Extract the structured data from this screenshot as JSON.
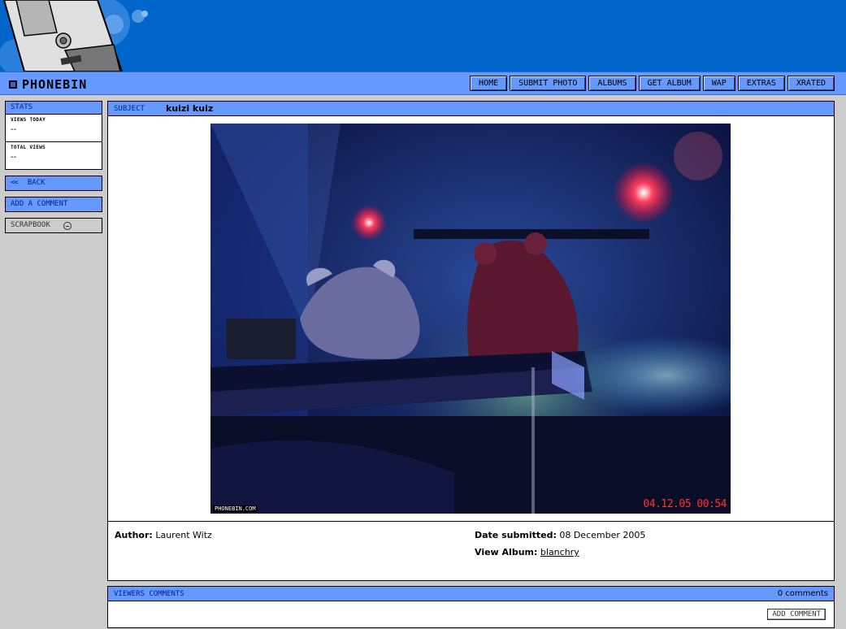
{
  "brand": {
    "logo_text": "PHONEBIN"
  },
  "nav": {
    "items": [
      "HOME",
      "SUBMIT PHOTO",
      "ALBUMS",
      "GET ALBUM",
      "WAP",
      "EXTRAS",
      "XRATED"
    ]
  },
  "sidebar": {
    "stats_title": "STATS",
    "views_today_label": "VIEWS TODAY",
    "views_today_value": "--",
    "total_views_label": "TOTAL VIEWS",
    "total_views_value": "--",
    "back_arrow": "<<",
    "back_label": "BACK",
    "add_comment_label": "ADD A COMMENT",
    "scrapbook_label": "SCRAPBOOK"
  },
  "photo": {
    "subject_label": "SUBJECT",
    "subject_title": "kuizi kuiz",
    "credit": "PHONEBIN.COM",
    "timestamp": "04.12.05 00:54"
  },
  "meta": {
    "author_label": "Author:",
    "author_value": "Laurent Witz",
    "date_label": "Date submitted:",
    "date_value": "08 December 2005",
    "album_label": "View Album:",
    "album_value": "blanchry"
  },
  "comments": {
    "title": "VIEWERS COMMENTS",
    "count": "0 comments",
    "add_label": "ADD COMMENT"
  },
  "colors": {
    "banner": "#0066cc",
    "nav": "#6699ff",
    "panel_bg": "#cccccc",
    "timestamp": "#ff3333"
  }
}
